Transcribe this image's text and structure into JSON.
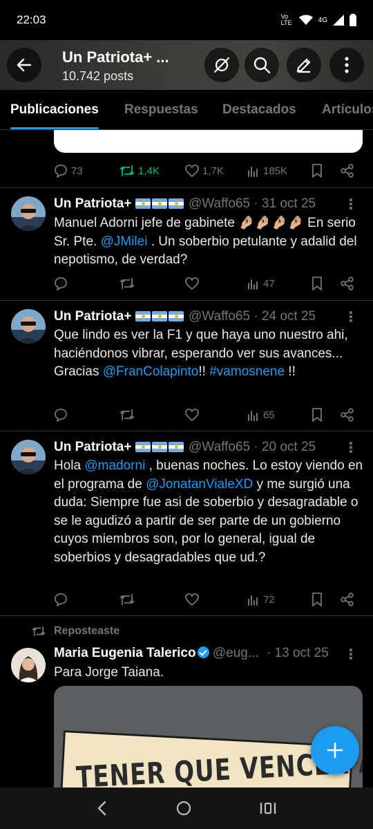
{
  "status": {
    "time": "22:03",
    "network": "Vo LTE",
    "signal_label": "4G"
  },
  "header": {
    "title": "Un Patriota+ ...",
    "posts": "10.742 posts"
  },
  "tabs": [
    "Publicaciones",
    "Respuestas",
    "Destacados",
    "Artículos"
  ],
  "first_actions": {
    "replies": "73",
    "reposts": "1,4K",
    "likes": "1,7K",
    "views": "185K"
  },
  "tweets": [
    {
      "name": "Un Patriota+",
      "handle": "@Waffo65",
      "date": "· 31 oct 25",
      "text_1": "Manuel Adorni jefe de gabinete 🤌🏼🤌🏼🤌🏼🤌🏼 En serio Sr. Pte. ",
      "mention_1": "@JMilei",
      "text_2": " . Un soberbio petulante y adalid del nepotismo, de verdad?",
      "views": "47"
    },
    {
      "name": "Un Patriota+",
      "handle": "@Waffo65",
      "date": "· 24 oct 25",
      "text_1": "Que lindo es ver la F1 y que haya uno nuestro ahi, haciéndonos vibrar, esperando ver  sus avances... Gracias ",
      "mention_1": "@FranColapinto",
      "text_2": "!! ",
      "hashtag": "#vamosnene",
      "text_3": " !!",
      "views": "65"
    },
    {
      "name": "Un Patriota+",
      "handle": "@Waffo65",
      "date": "· 20 oct 25",
      "text_1": "Hola ",
      "mention_1": "@madorni",
      "text_2": " , buenas noches. Lo estoy viendo en el programa de ",
      "mention_2": "@JonatanVialeXD",
      "text_3": " y me surgió una duda: Siempre fue asi de soberbio y desagradable o se le agudizó a partir de ser parte de un gobierno cuyos miembros son, por lo general, igual de soberbios y desagradables que ud.?",
      "views": "72"
    }
  ],
  "repost": {
    "label": "Reposteaste",
    "name": "Maria Eugenia Talerico",
    "handle": "@eug...",
    "date": "· 13 oct 25",
    "text": "Para Jorge Taiana.",
    "image_text": "TENER QUE VENCER A UN"
  },
  "colors": {
    "accent": "#1d9bf0",
    "repost_green": "#00ba7c",
    "muted": "#71767b"
  }
}
